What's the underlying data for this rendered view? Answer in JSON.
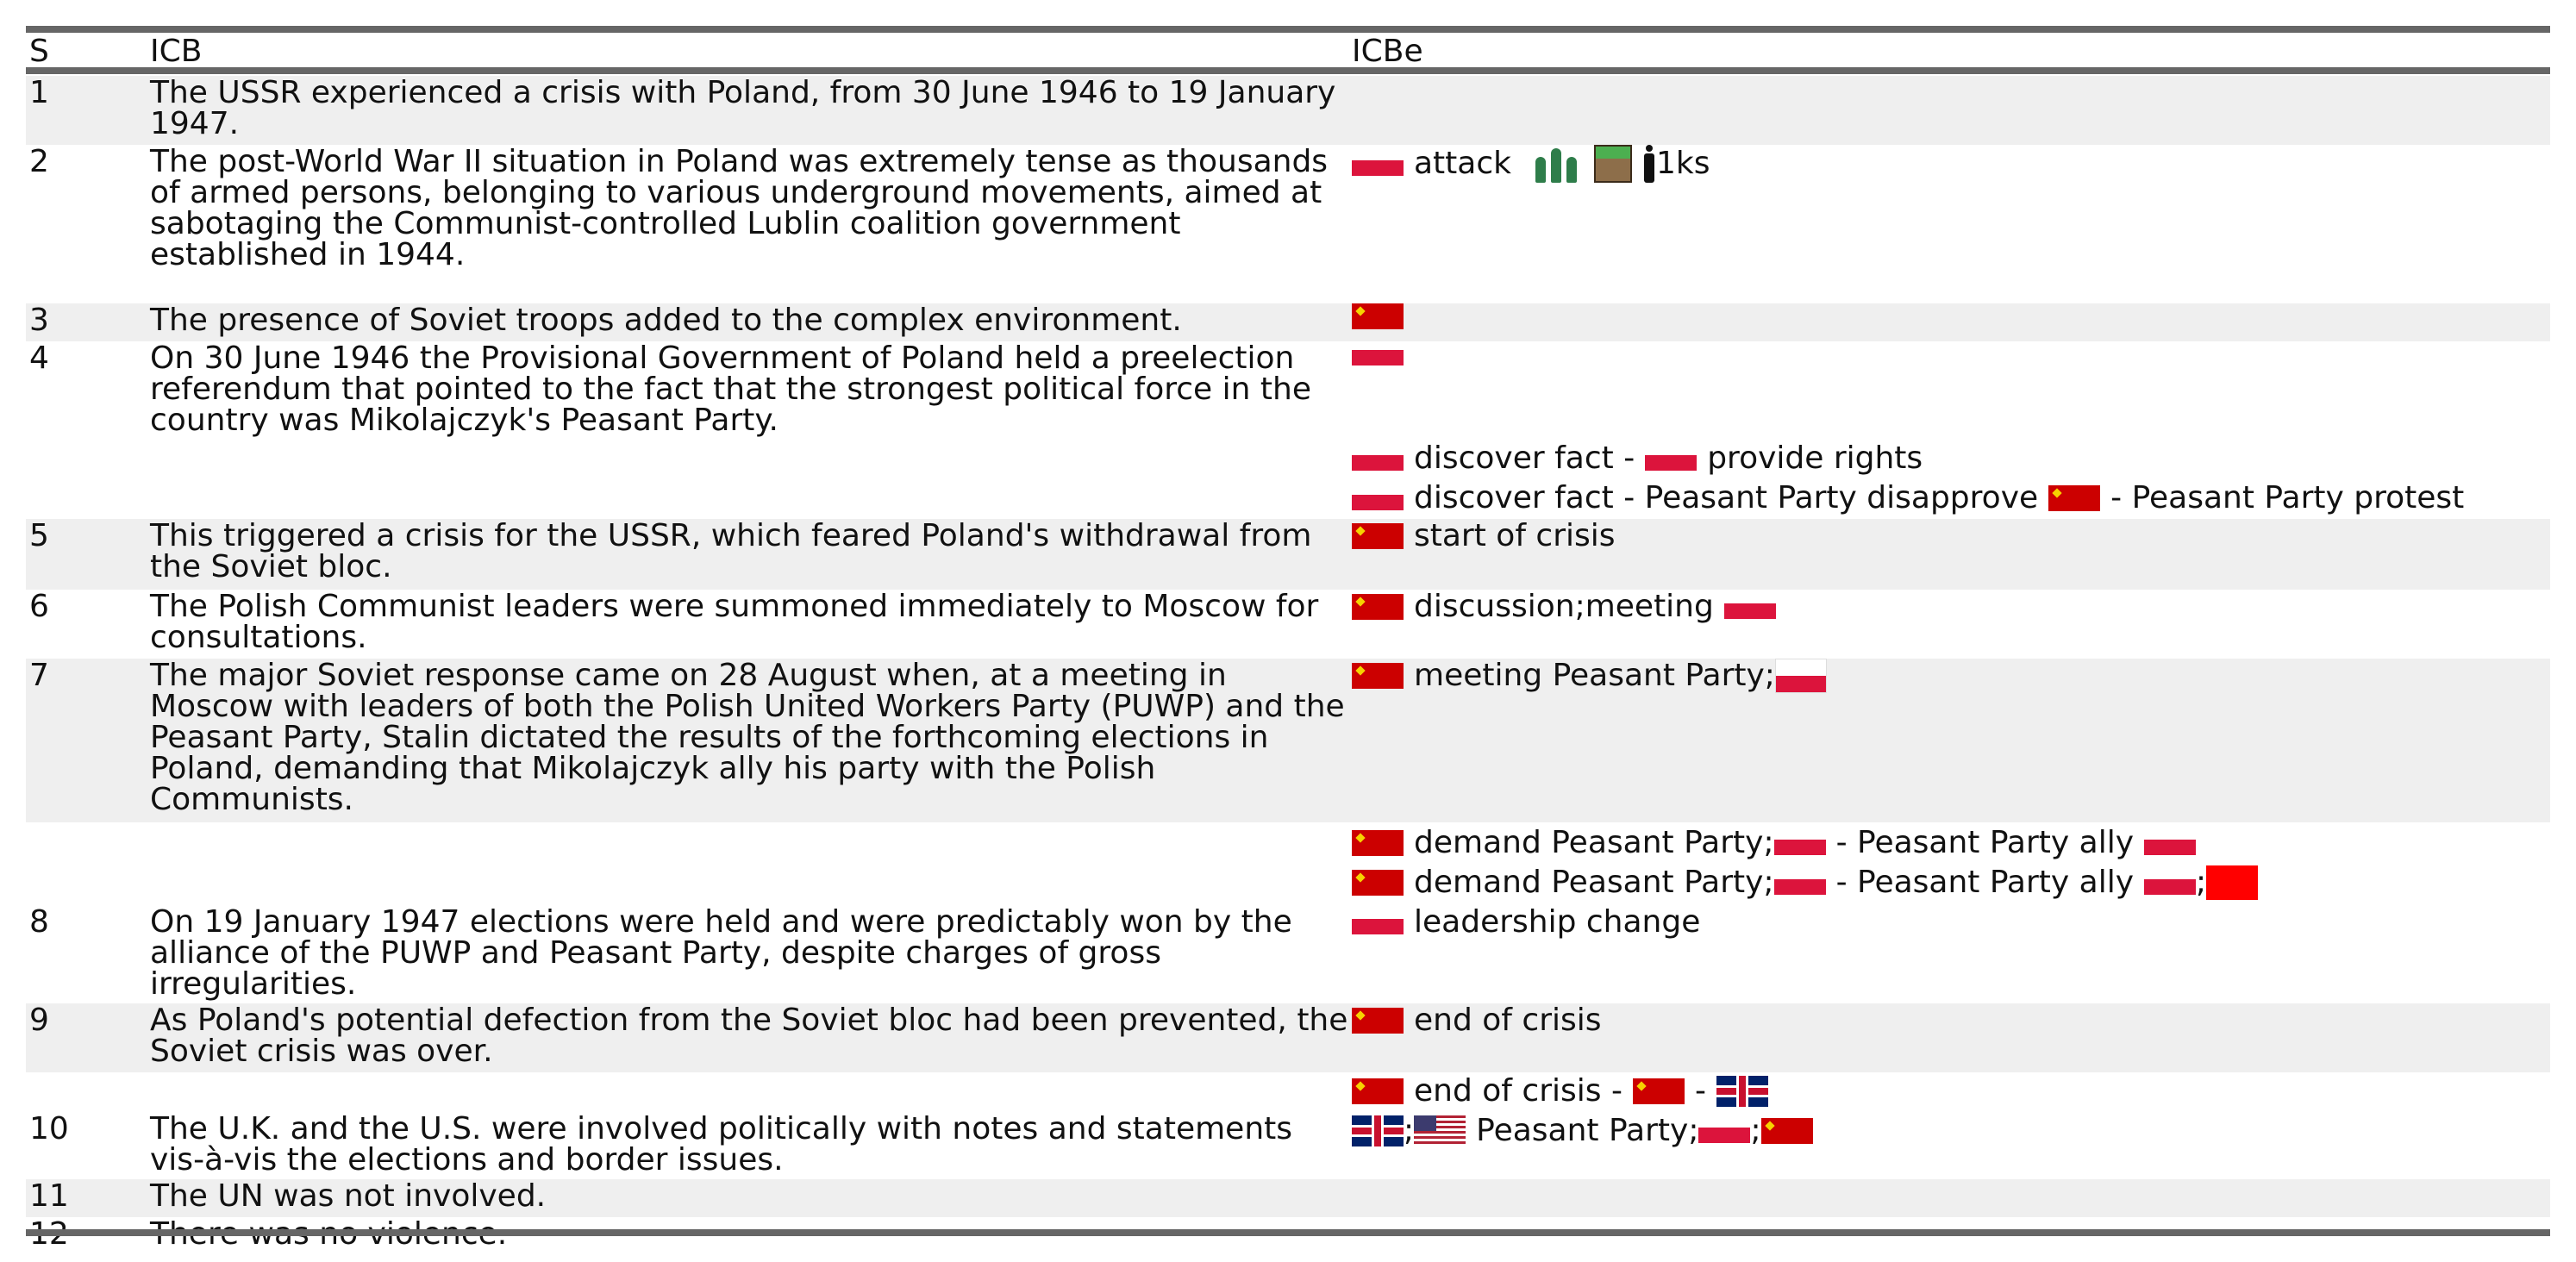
{
  "header": {
    "s": "S",
    "icb": "ICB",
    "icbe": "ICBe"
  },
  "rows": [
    {
      "s": "1",
      "icb": "The USSR experienced a crisis with Poland, from 30 June 1946 to 19 January 1947."
    },
    {
      "s": "2",
      "icb": "The post-World War II situation in Poland was extremely tense as thousands of armed persons, belonging to various underground movements, aimed at sabotaging the Communist-controlled Lublin coalition government established in 1944."
    },
    {
      "s": "3",
      "icb": "The presence of Soviet troops added to the complex environment."
    },
    {
      "s": "4",
      "icb": "On 30 June 1946 the Provisional Government of Poland held a preelection referendum that pointed to the fact that the strongest political force in the country was Mikolajczyk's Peasant Party."
    },
    {
      "s": "5",
      "icb": "This triggered a crisis for the USSR, which feared Poland's withdrawal from the Soviet bloc."
    },
    {
      "s": "6",
      "icb": "The Polish Communist leaders were summoned immediately to Moscow for consultations."
    },
    {
      "s": "7",
      "icb": "The major Soviet response came on 28 August when, at a meeting in Moscow with leaders of both the Polish United Workers Party (PUWP) and the Peasant Party, Stalin dictated the results of the forthcoming elections in Poland, demanding that Mikolajczyk ally his party with the Polish Communists."
    },
    {
      "s": "8",
      "icb": "On 19 January 1947 elections were held and were predictably won by the alliance of the PUWP and Peasant Party, despite charges of gross irregularities."
    },
    {
      "s": "9",
      "icb": "As Poland's potential defection from the Soviet bloc had been prevented, the Soviet crisis was over."
    },
    {
      "s": "10",
      "icb": "The U.K. and the U.S. were involved politically with notes and statements vis-à-vis the elections and border issues."
    },
    {
      "s": "11",
      "icb": "The UN was not involved."
    },
    {
      "s": "12",
      "icb": "There was no violence."
    }
  ],
  "events": {
    "e2_attack": "attack",
    "e2_count": "1ks",
    "e4b_a": "discover fact -",
    "e4b_b": "provide rights",
    "e4c_a": "discover fact - Peasant Party disapprove",
    "e4c_b": "- Peasant Party protest",
    "e5": "start of crisis",
    "e6": "discussion;meeting",
    "e7a": "meeting Peasant Party;",
    "e7b_a": "demand Peasant Party;",
    "e7b_b": "- Peasant Party ally",
    "e7c_a": "demand Peasant Party;",
    "e7c_b": "- Peasant Party ally",
    "e7c_sep": ";",
    "e8": "leadership change",
    "e9": "end of crisis",
    "e9b_a": "end of crisis -",
    "e9b_b": "-",
    "e10_sep1": ";",
    "e10_a": "Peasant Party;",
    "e10_sep2": ";"
  },
  "flags": {
    "ussr": "ussr-flag",
    "poland": "poland-flag",
    "uk": "uk-flag",
    "usa": "usa-flag"
  },
  "colors": {
    "rule": "#666666",
    "shade": "#efefef",
    "ussr_red": "#cc0000",
    "poland_red": "#dc143c"
  }
}
